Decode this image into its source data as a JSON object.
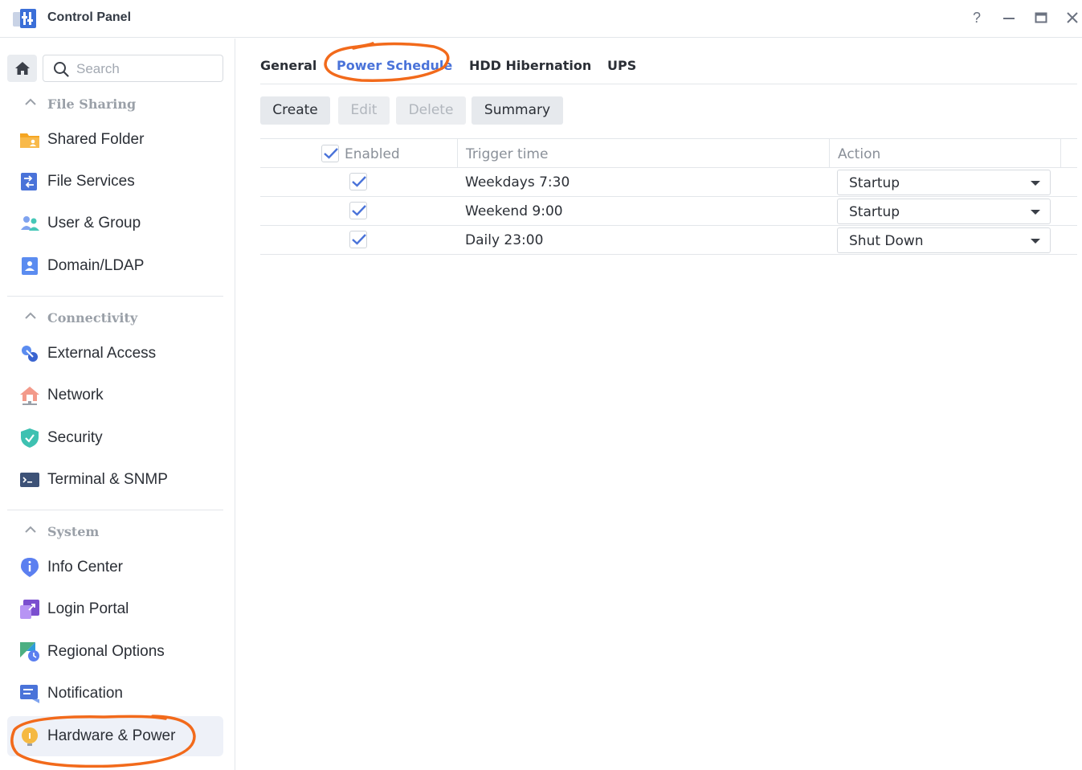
{
  "window": {
    "title": "Control Panel",
    "help_label": "?",
    "minimize_label": "—",
    "maximize_label": "▭",
    "close_label": "✕"
  },
  "sidebar": {
    "search_placeholder": "Search",
    "sections": [
      {
        "title": "File Sharing",
        "items": [
          {
            "label": "Shared Folder",
            "icon": "shared-folder-icon"
          },
          {
            "label": "File Services",
            "icon": "file-services-icon"
          },
          {
            "label": "User & Group",
            "icon": "user-group-icon"
          },
          {
            "label": "Domain/LDAP",
            "icon": "domain-ldap-icon"
          }
        ]
      },
      {
        "title": "Connectivity",
        "items": [
          {
            "label": "External Access",
            "icon": "external-access-icon"
          },
          {
            "label": "Network",
            "icon": "network-icon"
          },
          {
            "label": "Security",
            "icon": "security-icon"
          },
          {
            "label": "Terminal & SNMP",
            "icon": "terminal-icon"
          }
        ]
      },
      {
        "title": "System",
        "items": [
          {
            "label": "Info Center",
            "icon": "info-center-icon"
          },
          {
            "label": "Login Portal",
            "icon": "login-portal-icon"
          },
          {
            "label": "Regional Options",
            "icon": "regional-options-icon"
          },
          {
            "label": "Notification",
            "icon": "notification-icon"
          },
          {
            "label": "Hardware & Power",
            "icon": "hardware-power-icon",
            "active": true
          }
        ]
      }
    ]
  },
  "main": {
    "tabs": [
      {
        "label": "General"
      },
      {
        "label": "Power Schedule",
        "active": true
      },
      {
        "label": "HDD Hibernation"
      },
      {
        "label": "UPS"
      }
    ],
    "toolbar": {
      "create": "Create",
      "edit": "Edit",
      "delete": "Delete",
      "summary": "Summary"
    },
    "table": {
      "headers": {
        "enabled": "Enabled",
        "trigger_time": "Trigger time",
        "action": "Action"
      },
      "rows": [
        {
          "enabled": true,
          "trigger_time": "Weekdays 7:30",
          "action": "Startup"
        },
        {
          "enabled": true,
          "trigger_time": "Weekend 9:00",
          "action": "Startup"
        },
        {
          "enabled": true,
          "trigger_time": "Daily 23:00",
          "action": "Shut Down"
        }
      ]
    }
  },
  "colors": {
    "accent": "#4a73d9",
    "annotation": "#f26a1b",
    "active_nav_bg": "#eef1f8"
  }
}
